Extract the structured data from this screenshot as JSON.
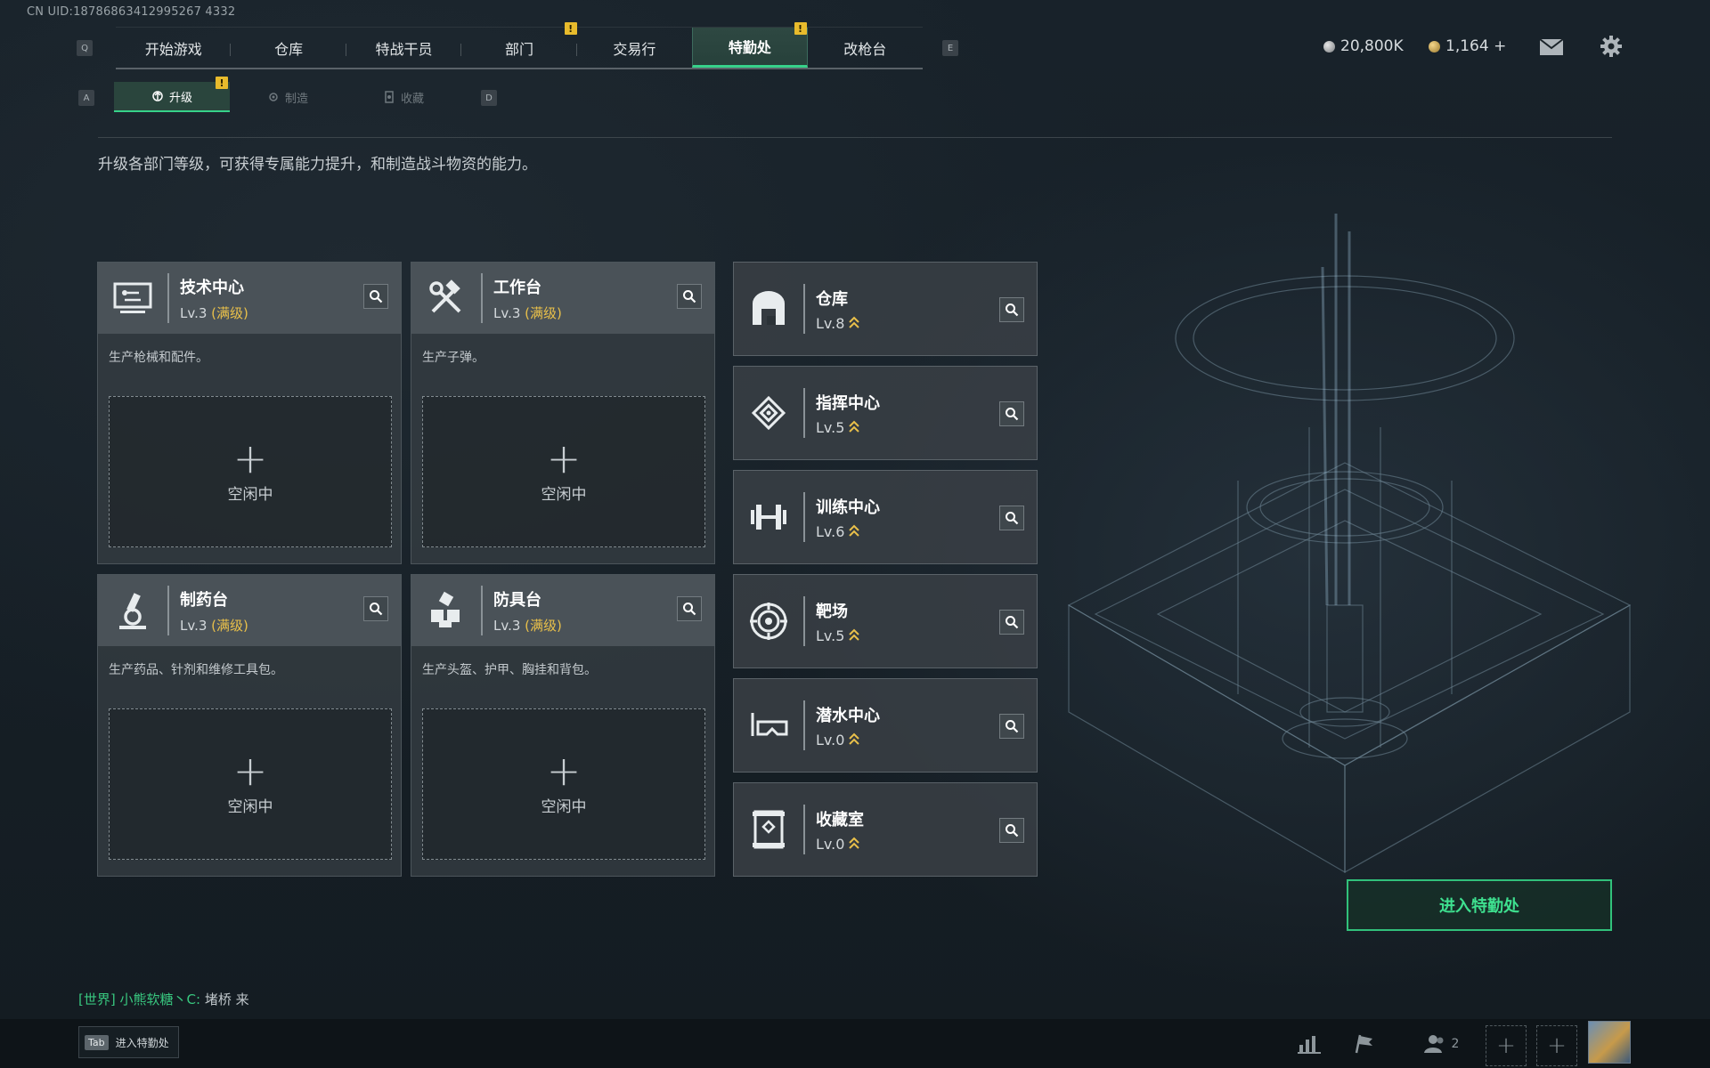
{
  "uid": "CN UID:18786863412995267 4332",
  "nav": {
    "key_left": "Q",
    "key_right": "E",
    "tabs": [
      {
        "label": "开始游戏"
      },
      {
        "label": "仓库"
      },
      {
        "label": "特战干员"
      },
      {
        "label": "部门",
        "alert": "!"
      },
      {
        "label": "交易行"
      },
      {
        "label": "特勤处",
        "alert": "!"
      },
      {
        "label": "改枪台"
      }
    ]
  },
  "currency": {
    "silver": "20,800K",
    "gold": "1,164 +"
  },
  "subnav": {
    "key_left": "A",
    "key_right": "D",
    "tabs": [
      {
        "label": "升级",
        "alert": "!"
      },
      {
        "label": "制造"
      },
      {
        "label": "收藏"
      }
    ]
  },
  "description": "升级各部门等级，可获得专属能力提升，和制造战斗物资的能力。",
  "workbenches": [
    {
      "name": "技术中心",
      "level": "Lv.3",
      "max": "(满级)",
      "desc": "生产枪械和配件。",
      "slot": "空闲中",
      "plus": "+"
    },
    {
      "name": "工作台",
      "level": "Lv.3",
      "max": "(满级)",
      "desc": "生产子弹。",
      "slot": "空闲中",
      "plus": "+"
    },
    {
      "name": "制药台",
      "level": "Lv.3",
      "max": "(满级)",
      "desc": "生产药品、针剂和维修工具包。",
      "slot": "空闲中",
      "plus": "+"
    },
    {
      "name": "防具台",
      "level": "Lv.3",
      "max": "(满级)",
      "desc": "生产头盔、护甲、胸挂和背包。",
      "slot": "空闲中",
      "plus": "+"
    }
  ],
  "facilities": [
    {
      "name": "仓库",
      "level": "Lv.8"
    },
    {
      "name": "指挥中心",
      "level": "Lv.5"
    },
    {
      "name": "训练中心",
      "level": "Lv.6"
    },
    {
      "name": "靶场",
      "level": "Lv.5"
    },
    {
      "name": "潜水中心",
      "level": "Lv.0"
    },
    {
      "name": "收藏室",
      "level": "Lv.0"
    }
  ],
  "enter_button": "进入特勤处",
  "chat": {
    "channel": "[世界]",
    "sender": "小熊软糖丶C:",
    "message": "堵桥  来"
  },
  "bottom": {
    "tab_key": "Tab",
    "tab_label": "进入特勤处",
    "friends_count": "2"
  }
}
